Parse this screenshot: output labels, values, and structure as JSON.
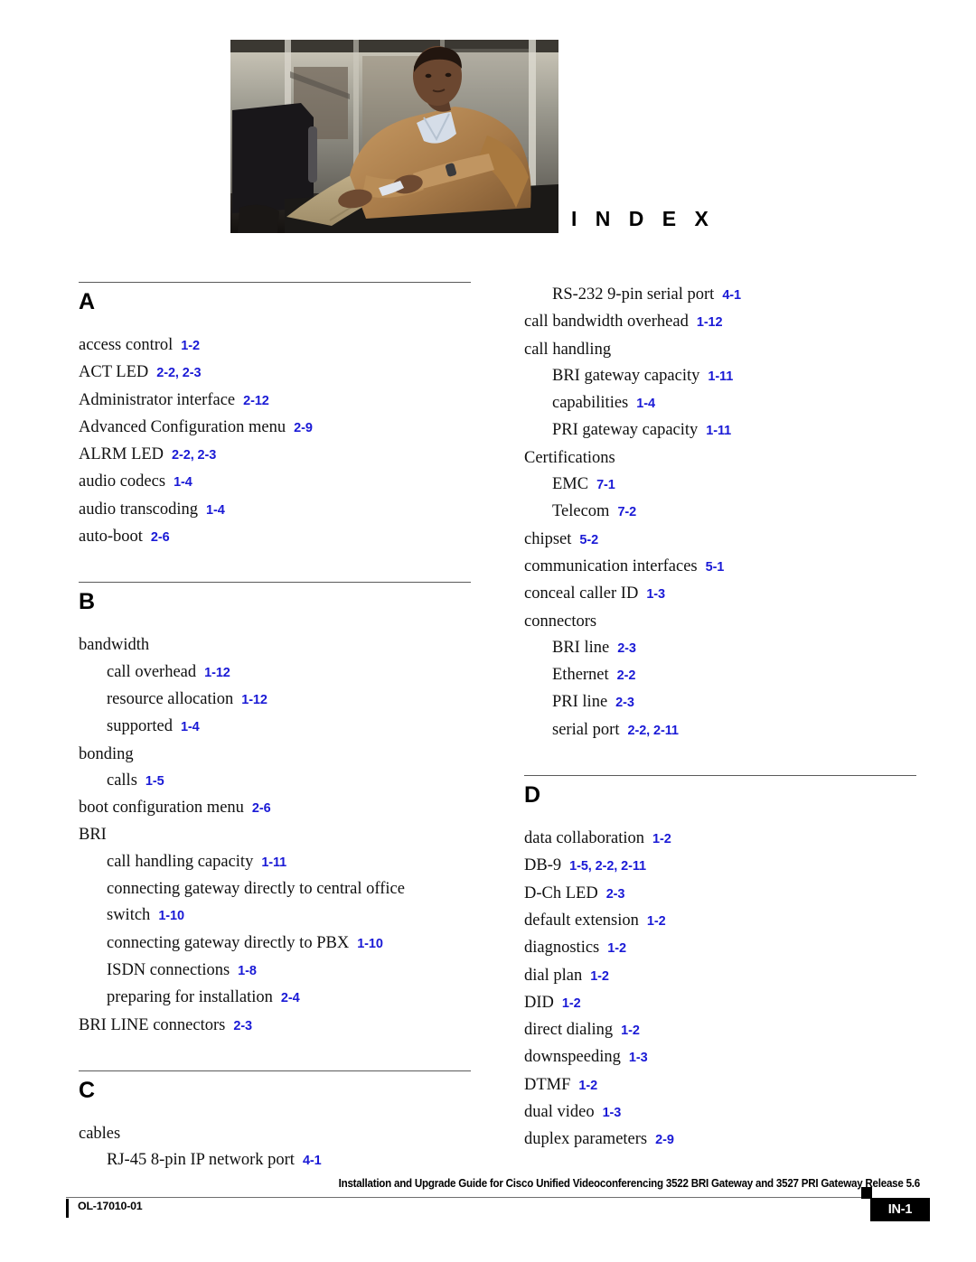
{
  "header": {
    "index_title": "I N D E X",
    "photo_alt": "man-in-tan-jacket-seated-in-office-lobby"
  },
  "columns": [
    {
      "id": "left",
      "letters": [
        {
          "letter": "A",
          "entries": [
            {
              "level": 1,
              "term": "access control",
              "refs": "1-2"
            },
            {
              "level": 1,
              "term": "ACT LED",
              "refs": "2-2, 2-3"
            },
            {
              "level": 1,
              "term": "Administrator interface",
              "refs": "2-12"
            },
            {
              "level": 1,
              "term": "Advanced Configuration menu",
              "refs": "2-9"
            },
            {
              "level": 1,
              "term": "ALRM LED",
              "refs": "2-2, 2-3"
            },
            {
              "level": 1,
              "term": "audio codecs",
              "refs": "1-4"
            },
            {
              "level": 1,
              "term": "audio transcoding",
              "refs": "1-4"
            },
            {
              "level": 1,
              "term": "auto-boot",
              "refs": "2-6"
            }
          ]
        },
        {
          "letter": "B",
          "entries": [
            {
              "level": 1,
              "term": "bandwidth",
              "refs": ""
            },
            {
              "level": 2,
              "term": "call overhead",
              "refs": "1-12"
            },
            {
              "level": 2,
              "term": "resource allocation",
              "refs": "1-12"
            },
            {
              "level": 2,
              "term": "supported",
              "refs": "1-4"
            },
            {
              "level": 1,
              "term": "bonding",
              "refs": ""
            },
            {
              "level": 2,
              "term": "calls",
              "refs": "1-5"
            },
            {
              "level": 1,
              "term": "boot configuration menu",
              "refs": "2-6"
            },
            {
              "level": 1,
              "term": "BRI",
              "refs": ""
            },
            {
              "level": 2,
              "term": "call handling capacity",
              "refs": "1-11"
            },
            {
              "level": 2,
              "term": "connecting gateway directly to central office switch",
              "refs": "1-10"
            },
            {
              "level": 2,
              "term": "connecting gateway directly to PBX",
              "refs": "1-10"
            },
            {
              "level": 2,
              "term": "ISDN connections",
              "refs": "1-8"
            },
            {
              "level": 2,
              "term": "preparing for installation",
              "refs": "2-4"
            },
            {
              "level": 1,
              "term": "BRI LINE connectors",
              "refs": "2-3"
            }
          ]
        },
        {
          "letter": "C",
          "entries": [
            {
              "level": 1,
              "term": "cables",
              "refs": ""
            },
            {
              "level": 2,
              "term": "RJ-45 8-pin IP network port",
              "refs": "4-1"
            }
          ]
        }
      ]
    },
    {
      "id": "right",
      "letters": [
        {
          "letter": "",
          "entries": [
            {
              "level": 2,
              "term": "RS-232 9-pin serial port",
              "refs": "4-1"
            },
            {
              "level": 1,
              "term": "call bandwidth overhead",
              "refs": "1-12"
            },
            {
              "level": 1,
              "term": "call handling",
              "refs": ""
            },
            {
              "level": 2,
              "term": "BRI gateway capacity",
              "refs": "1-11"
            },
            {
              "level": 2,
              "term": "capabilities",
              "refs": "1-4"
            },
            {
              "level": 2,
              "term": "PRI gateway capacity",
              "refs": "1-11"
            },
            {
              "level": 1,
              "term": "Certifications",
              "refs": ""
            },
            {
              "level": 2,
              "term": "EMC",
              "refs": "7-1"
            },
            {
              "level": 2,
              "term": "Telecom",
              "refs": "7-2"
            },
            {
              "level": 1,
              "term": "chipset",
              "refs": "5-2"
            },
            {
              "level": 1,
              "term": "communication interfaces",
              "refs": "5-1"
            },
            {
              "level": 1,
              "term": "conceal caller ID",
              "refs": "1-3"
            },
            {
              "level": 1,
              "term": "connectors",
              "refs": ""
            },
            {
              "level": 2,
              "term": "BRI line",
              "refs": "2-3"
            },
            {
              "level": 2,
              "term": "Ethernet",
              "refs": "2-2"
            },
            {
              "level": 2,
              "term": "PRI line",
              "refs": "2-3"
            },
            {
              "level": 2,
              "term": "serial port",
              "refs": "2-2, 2-11"
            }
          ]
        },
        {
          "letter": "D",
          "entries": [
            {
              "level": 1,
              "term": "data collaboration",
              "refs": "1-2"
            },
            {
              "level": 1,
              "term": "DB-9",
              "refs": "1-5, 2-2, 2-11"
            },
            {
              "level": 1,
              "term": "D-Ch LED",
              "refs": "2-3"
            },
            {
              "level": 1,
              "term": "default extension",
              "refs": "1-2"
            },
            {
              "level": 1,
              "term": "diagnostics",
              "refs": "1-2"
            },
            {
              "level": 1,
              "term": "dial plan",
              "refs": "1-2"
            },
            {
              "level": 1,
              "term": "DID",
              "refs": "1-2"
            },
            {
              "level": 1,
              "term": "direct dialing",
              "refs": "1-2"
            },
            {
              "level": 1,
              "term": "downspeeding",
              "refs": "1-3"
            },
            {
              "level": 1,
              "term": "DTMF",
              "refs": "1-2"
            },
            {
              "level": 1,
              "term": "dual video",
              "refs": "1-3"
            },
            {
              "level": 1,
              "term": "duplex parameters",
              "refs": "2-9"
            }
          ]
        }
      ]
    }
  ],
  "footer": {
    "title": "Installation and Upgrade Guide for Cisco Unified Videoconferencing 3522 BRI Gateway and 3527 PRI Gateway Release 5.6",
    "doc_id": "OL-17010-01",
    "page_number": "IN-1"
  },
  "colors": {
    "reference_blue": "#1a1ad6",
    "rule_gray": "#5a5a5a",
    "text_black": "#111111"
  }
}
